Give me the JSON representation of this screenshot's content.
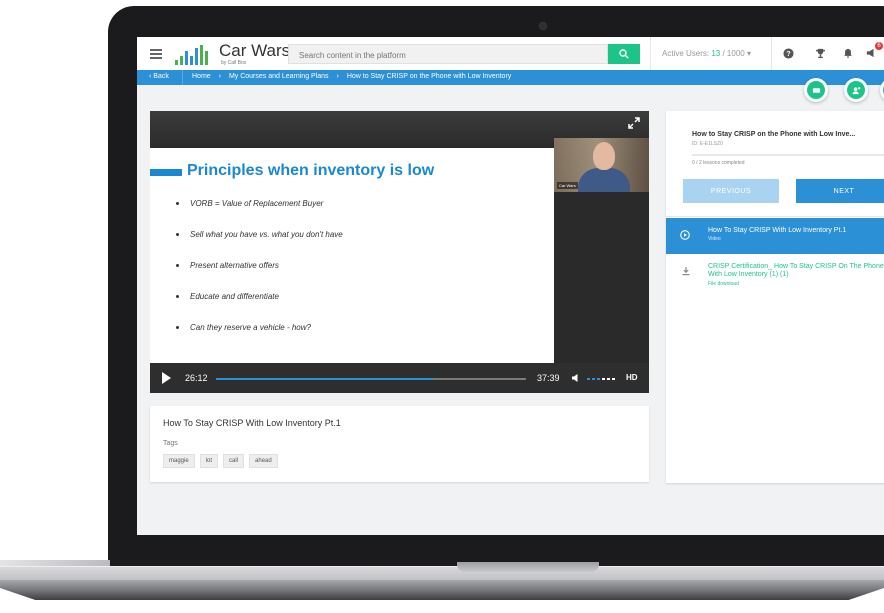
{
  "app": {
    "brand_name": "Car Wars",
    "brand_sub": "by Call Box",
    "colors": {
      "accent_blue": "#2c90d6",
      "accent_green": "#1dc48a",
      "badge_red": "#e53935"
    }
  },
  "topbar": {
    "search_placeholder": "Search content in the platform",
    "active_users_label": "Active Users:",
    "active_users_current": "13",
    "active_users_sep": " / 1000",
    "active_users_caret": "▾",
    "notification_count": "6",
    "icons": [
      "menu-icon",
      "search-icon",
      "help-icon",
      "trophy-icon",
      "bell-icon",
      "megaphone-icon"
    ]
  },
  "breadcrumb": {
    "back_label": "‹ Back",
    "items": [
      "Home",
      "›",
      "My Courses and Learning Plans",
      "›",
      "How to Stay CRISP on the Phone with Low Inventory"
    ]
  },
  "player": {
    "slide_title": "Principles when inventory is low",
    "bullets": [
      "VORB = Value of Replacement Buyer",
      "Sell what you have vs. what you don't have",
      "Present alternative offers",
      "Educate and differentiate",
      "Can they reserve a vehicle - how?"
    ],
    "webcam_tag": "Car Wars",
    "current_time": "26:12",
    "total_time": "37:39",
    "progress_fraction": 0.7,
    "quality_label": "HD"
  },
  "info": {
    "title": "How To Stay CRISP With Low Inventory Pt.1",
    "tags_label": "Tags",
    "tags": [
      "maggie",
      "lot",
      "call",
      "ahead"
    ]
  },
  "course": {
    "title": "How to Stay CRISP on the Phone with Low Inve...",
    "id_text": "ID: E-E1LSZ0",
    "lessons_completed_text": "0 / 2 lessons completed",
    "progress_fraction": 0,
    "previous_label": "PREVIOUS",
    "next_label": "NEXT",
    "lessons": [
      {
        "title": "How To Stay CRISP With Low Inventory Pt.1",
        "type": "Video",
        "active": true
      },
      {
        "title": "CRISP Certification_ How To Stay CRISP On The Phone With Low Inventory (1) (1)",
        "type": "File download",
        "active": false
      }
    ]
  }
}
